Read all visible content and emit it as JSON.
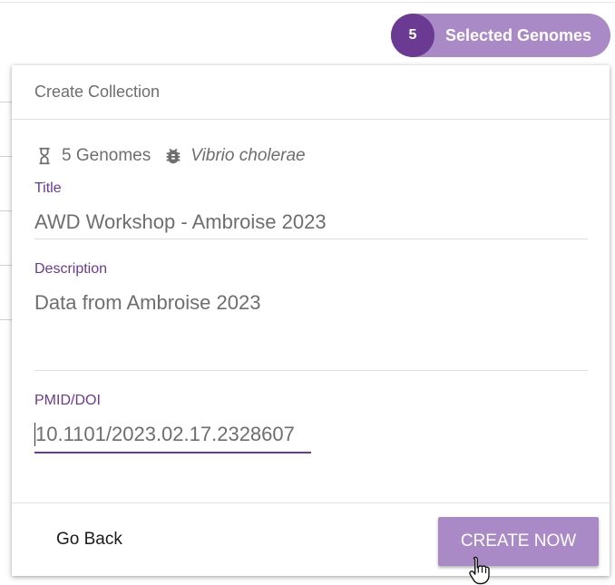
{
  "selection": {
    "count": "5",
    "label": "Selected Genomes"
  },
  "dialog": {
    "title": "Create Collection",
    "meta": {
      "genome_count_icon": "hourglass-icon",
      "genome_count": "5 Genomes",
      "species_icon": "bug-icon",
      "species": "Vibrio cholerae"
    },
    "fields": {
      "title": {
        "label": "Title",
        "value": "AWD Workshop - Ambroise 2023"
      },
      "description": {
        "label": "Description",
        "value": "Data from Ambroise 2023"
      },
      "pmid": {
        "label": "PMID/DOI",
        "value": "10.1101/2023.02.17.2328607"
      }
    },
    "actions": {
      "back_label": "Go Back",
      "create_label": "CREATE NOW"
    }
  },
  "colors": {
    "accent": "#6b3a93",
    "accent_light": "#a98ac7",
    "text_muted": "#6e6e6e"
  }
}
